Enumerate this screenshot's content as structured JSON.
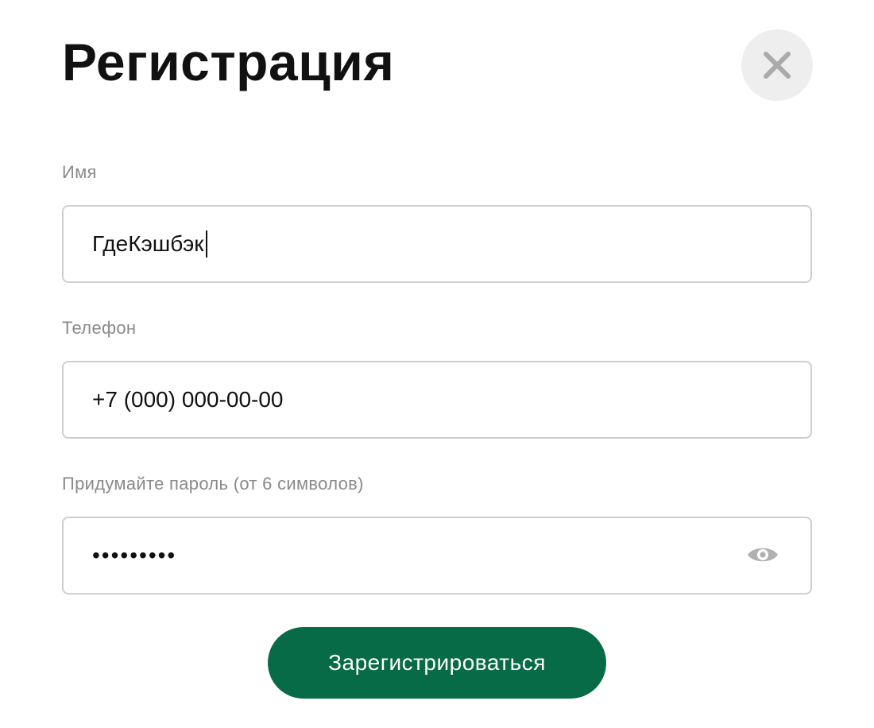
{
  "dialog": {
    "title": "Регистрация",
    "close_icon": "close-icon"
  },
  "form": {
    "name": {
      "label": "Имя",
      "value": "ГдеКэшбэк"
    },
    "phone": {
      "label": "Телефон",
      "value": "+7 (000) 000-00-00"
    },
    "password": {
      "label": "Придумайте пароль (от 6 символов)",
      "masked_value": "•••••••••",
      "toggle_icon": "eye-icon"
    },
    "submit_label": "Зарегистрироваться"
  },
  "colors": {
    "accent": "#086b47",
    "close_bg": "#eeeeee",
    "icon_gray": "#aaaaaa",
    "border": "#cfcfcf",
    "label": "#8a8a8a"
  }
}
